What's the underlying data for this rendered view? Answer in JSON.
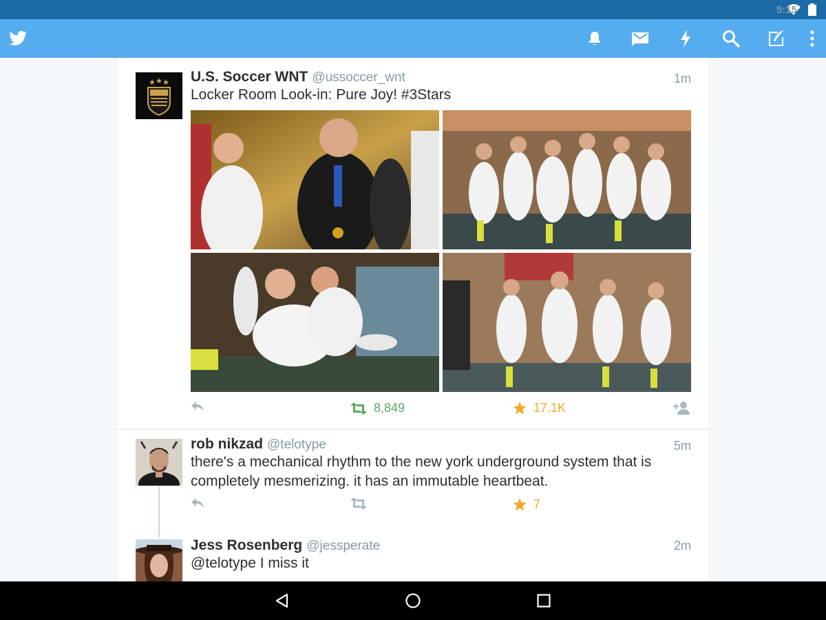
{
  "status_bar": {
    "time": "5:15"
  },
  "app_bar": {
    "logo_icon": "twitter-bird-icon",
    "actions": [
      "notifications-bell-icon",
      "messages-envelope-icon",
      "discover-lightning-icon",
      "search-icon",
      "compose-tweet-icon",
      "overflow-menu-icon"
    ],
    "color": "#55acee"
  },
  "tweets": [
    {
      "name": "U.S. Soccer WNT",
      "handle": "@ussoccer_wnt",
      "time": "1m",
      "text": "Locker Room Look-in: Pure Joy! #3Stars",
      "retweets": "8,849",
      "favorites": "17.1K"
    },
    {
      "name": "rob  nikzad",
      "handle": "@telotype",
      "time": "5m",
      "text": "there's a mechanical rhythm to the new york underground system that is completely mesmerizing. it has an immutable heartbeat.",
      "retweets": "",
      "favorites": "7"
    },
    {
      "name": "Jess Rosenberg",
      "handle": "@jessperate",
      "time": "2m",
      "text": "@telotype I miss it"
    }
  ],
  "colors": {
    "retweet_green": "#5ea85e",
    "favorite_orange": "#f5a623",
    "muted_gray": "#aab8c2",
    "statusbar": "#1b6aa5"
  },
  "nav_bar": {
    "buttons": [
      "back-icon",
      "home-icon",
      "recents-icon"
    ]
  }
}
